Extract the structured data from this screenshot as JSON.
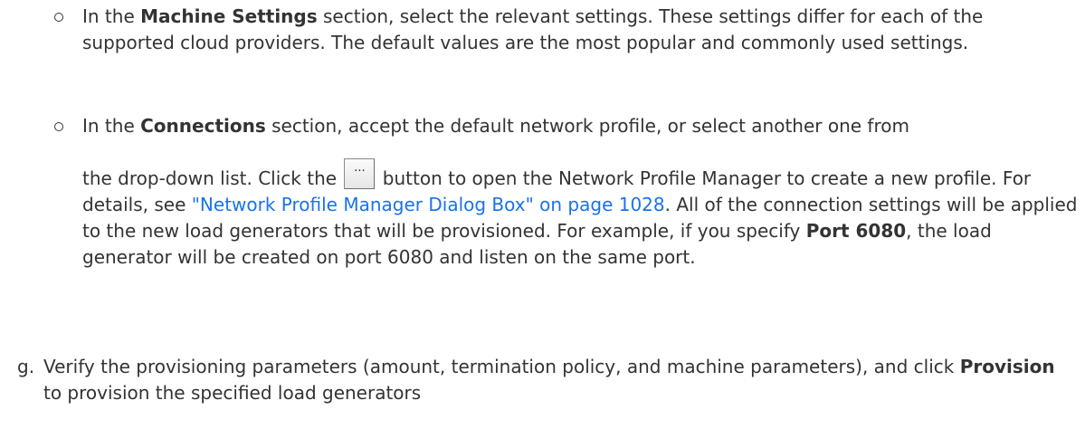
{
  "item_machine": {
    "t1": "In the ",
    "b1": "Machine Settings",
    "t2": " section, select the relevant settings. These settings differ for each of the supported cloud providers. The default values are the most popular and commonly used settings."
  },
  "item_connections": {
    "t1": "In the ",
    "b1": "Connections",
    "t2": " section, accept the default network profile, or select another one from",
    "t3": "the drop-down list. Click the",
    "button_label": "...",
    "t4": "button to open the Network Profile Manager to create a new profile. For details, see ",
    "link": "\"Network Profile Manager Dialog Box\" on page 1028",
    "t5": ". All of the connection settings will be applied to the new load generators that will be provisioned. For example, if you specify ",
    "b2": "Port 6080",
    "t6": ", the load generator will be created on port 6080 and listen on the same port."
  },
  "step_g": {
    "marker": "g.",
    "t1": "Verify the provisioning parameters (amount, termination policy, and machine parameters), and click ",
    "b1": "Provision",
    "t2": " to provision the specified load generators"
  }
}
